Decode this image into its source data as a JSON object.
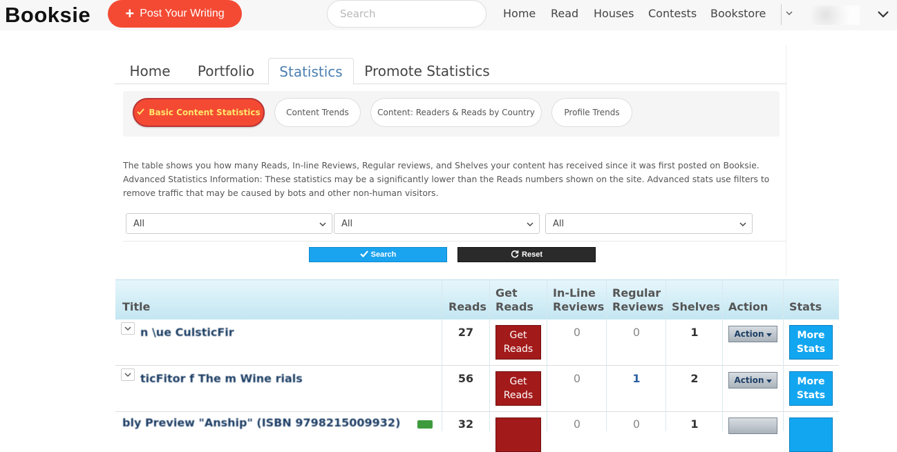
{
  "header": {
    "logo": "Booksie",
    "post_button": "Post Your Writing",
    "search_placeholder": "Search",
    "nav": [
      "Home",
      "Read",
      "Houses",
      "Contests",
      "Bookstore"
    ]
  },
  "tabs": [
    "Home",
    "Portfolio",
    "Statistics",
    "Promote Statistics"
  ],
  "subtabs": [
    "Basic Content Statistics",
    "Content Trends",
    "Content: Readers & Reads by Country",
    "Profile Trends"
  ],
  "description": "The table shows you how many Reads, In-line Reviews, Regular reviews, and Shelves your content has received since it was first posted on Booksie. Advanced Statistics Information: These statistics may be a significantly lower than the Reads numbers shown on the site. Advanced stats use filters to remove traffic that may be caused by bots and other non-human visitors.",
  "filters": [
    "All",
    "All",
    "All"
  ],
  "buttons": {
    "search": "Search",
    "reset": "Reset"
  },
  "table": {
    "headers": {
      "title": "Title",
      "reads": "Reads",
      "get_reads_1": "Get",
      "get_reads_2": "Reads",
      "inline_1": "In-Line",
      "inline_2": "Reviews",
      "regular_1": "Regular",
      "regular_2": "Reviews",
      "shelves": "Shelves",
      "action": "Action",
      "stats": "Stats"
    },
    "rows": [
      {
        "title": "n \\ue CulsticFir",
        "reads": "27",
        "inline": "0",
        "regular": "0",
        "shelves": "1"
      },
      {
        "title": "ticFitor f The m Wine rials",
        "reads": "56",
        "inline": "0",
        "regular": "1",
        "shelves": "2"
      },
      {
        "title": "bly Preview  \"Anship\" (ISBN 9798215009932)",
        "reads": "32",
        "inline": "0",
        "regular": "0",
        "shelves": "1"
      }
    ],
    "get_reads_label_1": "Get",
    "get_reads_label_2": "Reads",
    "action_label": "Action",
    "stats_label_1": "More",
    "stats_label_2": "Stats"
  },
  "colors": {
    "accent": "#f44a33",
    "search_blue": "#1aa3ee",
    "get_reads_red": "#a31a1a",
    "stats_blue": "#13a6f0"
  }
}
